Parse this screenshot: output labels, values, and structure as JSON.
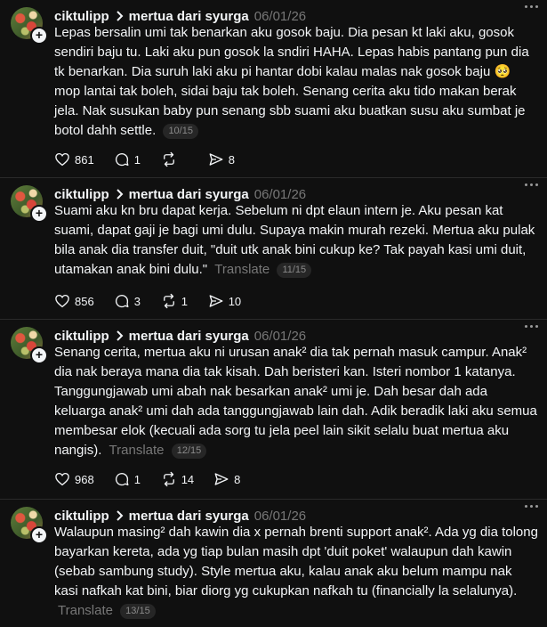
{
  "posts": [
    {
      "username": "ciktulipp",
      "topic": "mertua dari syurga",
      "date": "06/01/26",
      "text": "Lepas bersalin umi tak benarkan aku gosok baju. Dia pesan kt laki aku, gosok sendiri baju tu. Laki aku pun gosok la sndiri HAHA. Lepas habis pantang pun dia tk benarkan. Dia suruh laki aku pi hantar dobi kalau malas nak gosok baju 🥺 mop lantai tak boleh, sidai baju tak boleh. Senang cerita aku tido makan berak jela. Nak susukan baby pun senang sbb suami aku buatkan susu aku sumbat je botol dahh settle.",
      "translate": "",
      "pager": "10/15",
      "likes": "861",
      "replies": "1",
      "reposts": "",
      "shares": "8"
    },
    {
      "username": "ciktulipp",
      "topic": "mertua dari syurga",
      "date": "06/01/26",
      "text": "Suami aku kn bru dapat kerja. Sebelum ni dpt elaun intern je. Aku pesan kat suami, dapat gaji je bagi umi dulu. Supaya makin murah rezeki. Mertua aku pulak bila anak dia transfer duit, \"duit utk anak bini cukup ke? Tak payah kasi umi duit, utamakan anak bini dulu.\"",
      "translate": "Translate",
      "pager": "11/15",
      "likes": "856",
      "replies": "3",
      "reposts": "1",
      "shares": "10"
    },
    {
      "username": "ciktulipp",
      "topic": "mertua dari syurga",
      "date": "06/01/26",
      "text": "Senang cerita, mertua aku ni urusan anak² dia tak pernah masuk campur. Anak² dia nak beraya mana dia tak kisah. Dah beristeri kan. Isteri nombor 1 katanya. Tanggungjawab umi abah nak besarkan anak² umi je. Dah besar dah ada keluarga anak² umi dah ada tanggungjawab lain dah. Adik beradik laki aku semua membesar elok (kecuali ada sorg tu jela peel lain sikit selalu buat mertua aku nangis).",
      "translate": "Translate",
      "pager": "12/15",
      "likes": "968",
      "replies": "1",
      "reposts": "14",
      "shares": "8"
    },
    {
      "username": "ciktulipp",
      "topic": "mertua dari syurga",
      "date": "06/01/26",
      "text": "Walaupun masing² dah kawin dia x pernah brenti support anak². Ada yg dia tolong bayarkan kereta, ada yg tiap bulan masih dpt 'duit poket' walaupun dah kawin (sebab sambung study). Style mertua aku, kalau anak aku belum mampu nak kasi nafkah kat bini, biar diorg yg cukupkan nafkah tu (financially la selalunya).",
      "translate": "Translate",
      "pager": "13/15",
      "likes": "",
      "replies": "",
      "reposts": "",
      "shares": ""
    }
  ],
  "icons": {
    "like": "heart-icon",
    "reply": "comment-icon",
    "repost": "repost-icon",
    "share": "send-icon",
    "more": "more-icon",
    "follow": "plus-icon",
    "chevron": "chevron-right-icon"
  }
}
